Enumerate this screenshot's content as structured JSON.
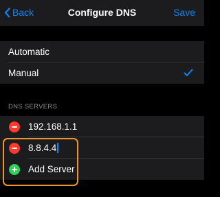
{
  "navbar": {
    "back_label": "Back",
    "title": "Configure DNS",
    "save_label": "Save"
  },
  "mode": {
    "options": [
      {
        "label": "Automatic"
      },
      {
        "label": "Manual"
      }
    ],
    "selected": "Manual"
  },
  "dns_servers": {
    "header": "DNS SERVERS",
    "servers": [
      "192.168.1.1",
      "8.8.4.4"
    ],
    "add_label": "Add Server"
  },
  "colors": {
    "accent": "#0a84ff",
    "delete": "#ff3b30",
    "add": "#30d158",
    "highlight": "#f0972a"
  },
  "icons": {
    "back": "chevron-left-icon",
    "check": "checkmark-icon",
    "remove": "minus-circle-icon",
    "add": "plus-circle-icon"
  }
}
